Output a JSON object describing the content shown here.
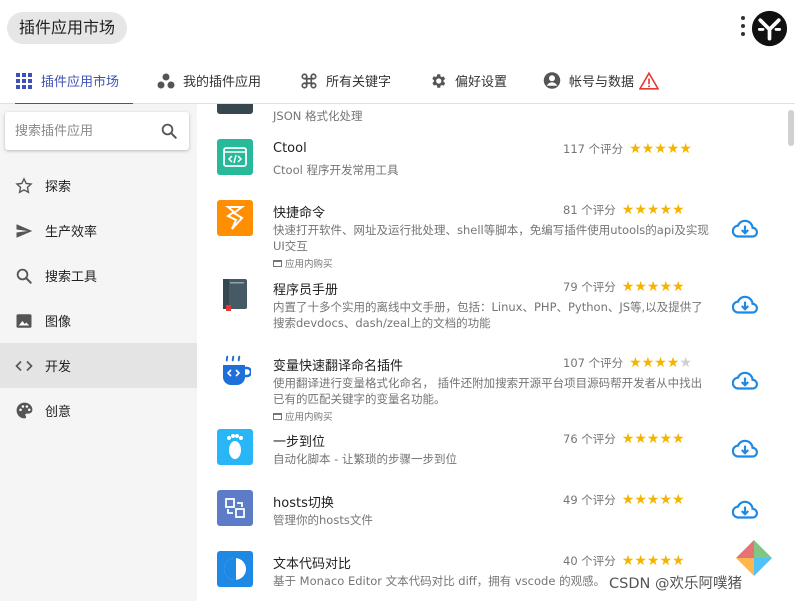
{
  "window": {
    "title": "插件应用市场"
  },
  "tabs": [
    {
      "label": "插件应用市场",
      "icon": "grid-icon"
    },
    {
      "label": "我的插件应用",
      "icon": "dots-icon"
    },
    {
      "label": "所有关键字",
      "icon": "command-icon"
    },
    {
      "label": "偏好设置",
      "icon": "gear-icon"
    },
    {
      "label": "帐号与数据",
      "icon": "account-icon"
    }
  ],
  "sidebar": {
    "search_placeholder": "搜索插件应用",
    "categories": [
      {
        "label": "探索",
        "icon": "star-outline-icon"
      },
      {
        "label": "生产效率",
        "icon": "send-icon"
      },
      {
        "label": "搜索工具",
        "icon": "search-icon"
      },
      {
        "label": "图像",
        "icon": "image-icon"
      },
      {
        "label": "开发",
        "icon": "code-icon"
      },
      {
        "label": "创意",
        "icon": "palette-icon"
      }
    ],
    "active_category": "开发"
  },
  "plugins": [
    {
      "name": "",
      "desc": "JSON 格式化处理",
      "rating_text": "",
      "stars": 0,
      "in_app_purchase": false,
      "icon_color": "#37474f"
    },
    {
      "name": "Ctool",
      "desc": "Ctool 程序开发常用工具",
      "rating_text": "117 个评分",
      "stars": 5,
      "in_app_purchase": false,
      "icon_color": "#26b99a"
    },
    {
      "name": "快捷命令",
      "desc": "快速打开软件、网址及运行批处理、shell等脚本，免编写插件使用utools的api及实现UI交互",
      "rating_text": "81 个评分",
      "stars": 5,
      "in_app_purchase": true,
      "icon_color": "#ff8f00"
    },
    {
      "name": "程序员手册",
      "desc": "内置了十多个实用的离线中文手册，包括：Linux、PHP、Python、JS等,以及提供了搜索devdocs、dash/zeal上的文档的功能",
      "rating_text": "79 个评分",
      "stars": 5,
      "in_app_purchase": false,
      "icon_color": "#455a64"
    },
    {
      "name": "变量快速翻译命名插件",
      "desc": "使用翻译进行变量格式化命名， 插件还附加搜索开源平台项目源码帮开发者从中找出已有的匹配关键字的变量名功能。",
      "rating_text": "107 个评分",
      "stars": 4,
      "in_app_purchase": true,
      "icon_color": "#1e6fd9"
    },
    {
      "name": "一步到位",
      "desc": "自动化脚本 - 让繁琐的步骤一步到位",
      "rating_text": "76 个评分",
      "stars": 5,
      "in_app_purchase": false,
      "icon_color": "#29b6f6"
    },
    {
      "name": "hosts切换",
      "desc": "管理你的hosts文件",
      "rating_text": "49 个评分",
      "stars": 5,
      "in_app_purchase": false,
      "icon_color": "#5c7cc8"
    },
    {
      "name": "文本代码对比",
      "desc": "基于 Monaco Editor 文本代码对比 diff，拥有 vscode 的观感。",
      "rating_text": "40 个评分",
      "stars": 5,
      "in_app_purchase": false,
      "icon_color": "#1e88e5"
    }
  ],
  "purchase_label": "应用内购买",
  "watermark": "CSDN @欢乐阿噗猪",
  "colors": {
    "accent": "#3f51b5",
    "star": "#f4b400",
    "download": "#1e88e5",
    "warning": "#e53935"
  }
}
